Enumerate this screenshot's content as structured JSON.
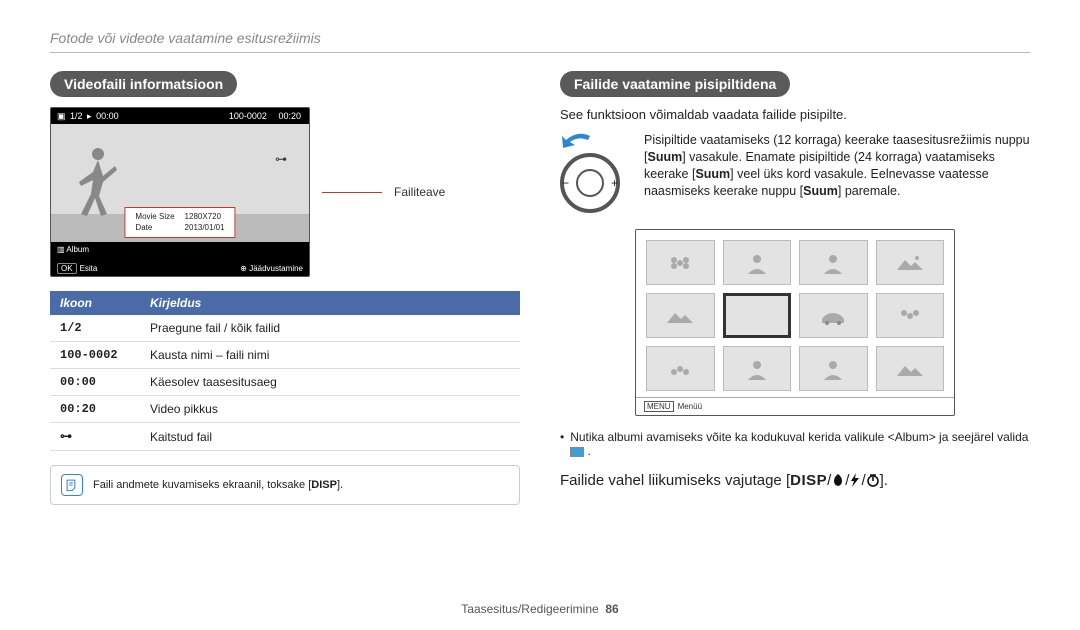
{
  "breadcrumb": "Fotode või videote vaatamine esitusrežiimis",
  "left": {
    "heading": "Videofaili informatsioon",
    "preview": {
      "counter": "1/2",
      "time_a": "00:00",
      "folder_file": "100-0002",
      "time_b": "00:20",
      "movie_size_label": "Movie Size",
      "movie_size_value": "1280X720",
      "date_label": "Date",
      "date_value": "2013/01/01",
      "album_icon_label": "Album",
      "ok_label": "OK",
      "play_label": "Esita",
      "capture_label": "Jäädvustamine"
    },
    "callout": "Failiteave",
    "table": {
      "head_icon": "Ikoon",
      "head_desc": "Kirjeldus",
      "rows": [
        {
          "icon": "1/2",
          "desc": "Praegune fail / kõik failid"
        },
        {
          "icon": "100-0002",
          "desc": "Kausta nimi – faili nimi"
        },
        {
          "icon": "00:00",
          "desc": "Käesolev taasesitusaeg"
        },
        {
          "icon": "00:20",
          "desc": "Video pikkus"
        },
        {
          "icon": "⊶",
          "desc": "Kaitstud fail"
        }
      ]
    },
    "note": "Faili andmete kuvamiseks ekraanil, toksake [",
    "note_disp": "DISP",
    "note_end": "]."
  },
  "right": {
    "heading": "Failide vaatamine pisipiltidena",
    "intro": "See funktsioon võimaldab vaadata failide pisipilte.",
    "dial_text_1": "Pisipiltide vaatamiseks (12 korraga) keerake taasesitusrežiimis nuppu ",
    "dial_text_2": " vasakule. Enamate pisipiltide (24 korraga) vaatamiseks keerake ",
    "dial_text_3": " veel üks kord vasakule. Eelnevasse vaatesse naasmiseks keerake nuppu ",
    "dial_text_4": " paremale.",
    "suum": "Suum",
    "menu_label": "MENU",
    "menu_text": "Menüü",
    "bullet": "Nutika albumi avamiseks võite ka kodukuval kerida valikule  <Album>  ja seejärel valida ",
    "navline_a": "Failide vahel liikumiseks vajutage [",
    "navline_disp": "DISP",
    "navline_b": "].",
    "nav_sep": "/"
  },
  "footer": {
    "section": "Taasesitus/Redigeerimine",
    "page": "86"
  }
}
